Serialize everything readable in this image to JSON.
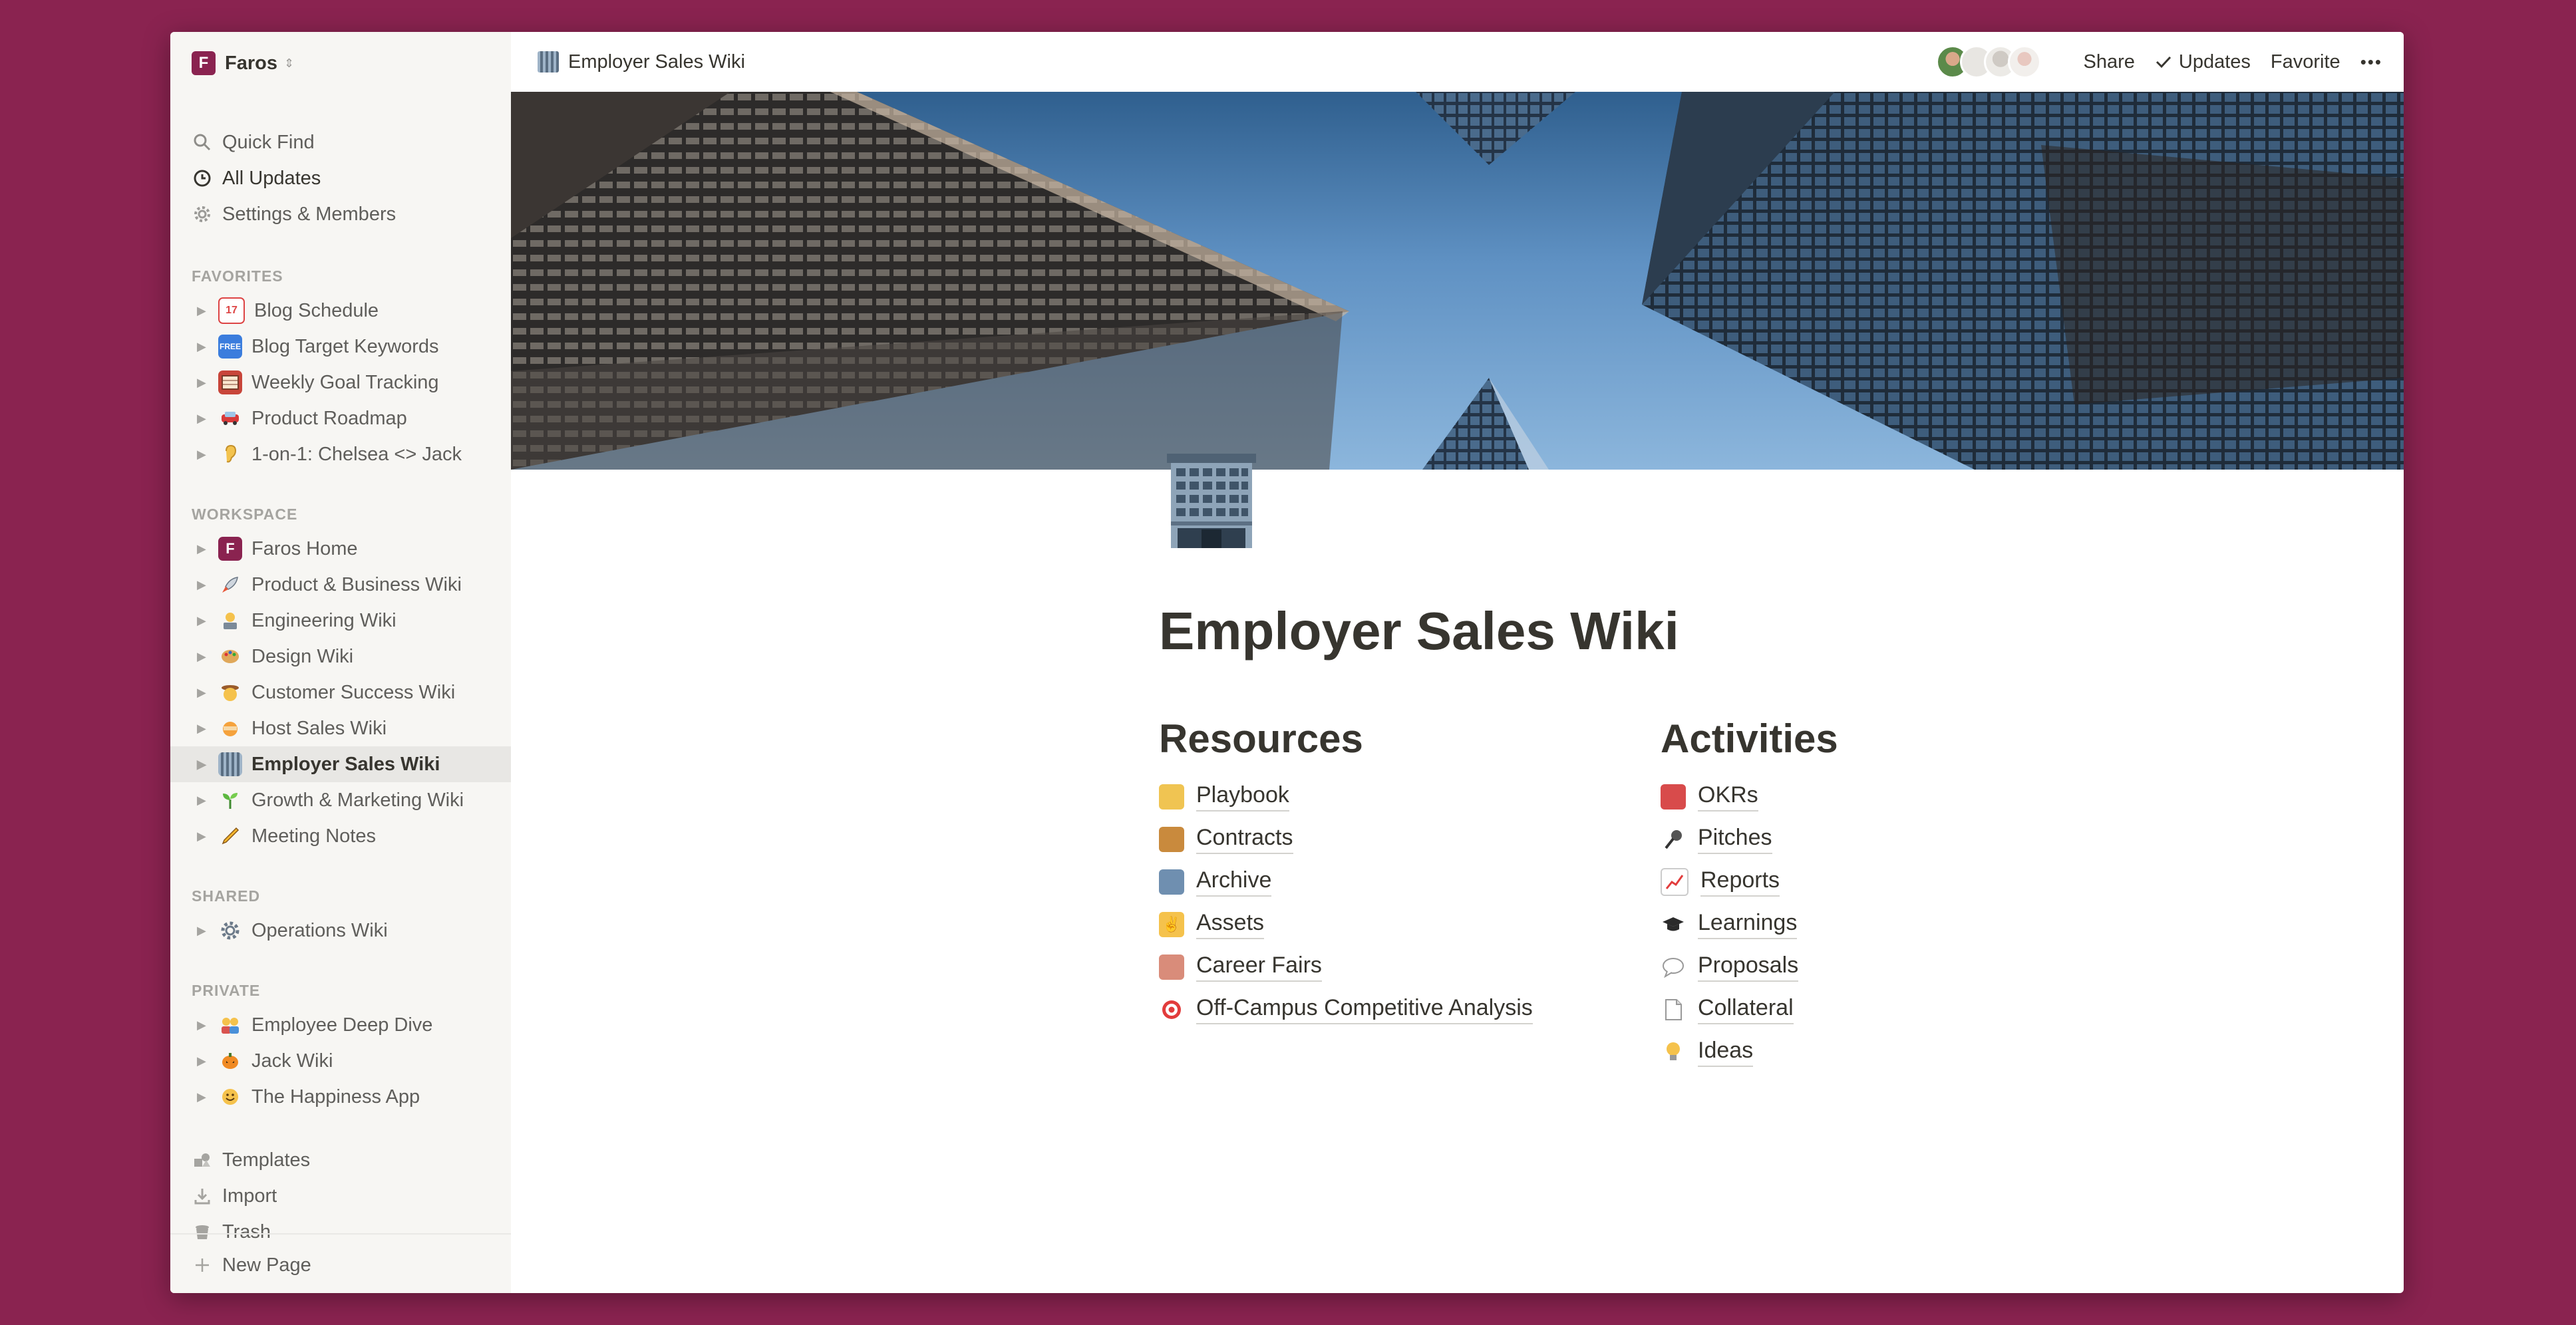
{
  "workspace": {
    "name": "Faros",
    "logo_letter": "F"
  },
  "sidebar": {
    "top_items": [
      {
        "label": "Quick Find",
        "icon": "search-icon"
      },
      {
        "label": "All Updates",
        "icon": "clock-icon"
      },
      {
        "label": "Settings & Members",
        "icon": "gear-icon"
      }
    ],
    "sections": {
      "favorites": "FAVORITES",
      "workspace": "WORKSPACE",
      "shared": "SHARED",
      "private": "PRIVATE"
    },
    "favorites": [
      {
        "label": "Blog Schedule",
        "icon": "calendar-icon"
      },
      {
        "label": "Blog Target Keywords",
        "icon": "free-badge-icon"
      },
      {
        "label": "Weekly Goal Tracking",
        "icon": "abacus-icon"
      },
      {
        "label": "Product Roadmap",
        "icon": "car-icon"
      },
      {
        "label": "1-on-1: Chelsea <> Jack",
        "icon": "ear-icon"
      }
    ],
    "workspace_pages": [
      {
        "label": "Faros Home",
        "icon": "faros-logo-icon"
      },
      {
        "label": "Product & Business Wiki",
        "icon": "rocket-icon"
      },
      {
        "label": "Engineering Wiki",
        "icon": "technologist-icon"
      },
      {
        "label": "Design Wiki",
        "icon": "palette-icon"
      },
      {
        "label": "Customer Success Wiki",
        "icon": "cowboy-icon"
      },
      {
        "label": "Host Sales Wiki",
        "icon": "ninja-icon"
      },
      {
        "label": "Employer Sales Wiki",
        "icon": "office-building-icon"
      },
      {
        "label": "Growth & Marketing Wiki",
        "icon": "seedling-icon"
      },
      {
        "label": "Meeting Notes",
        "icon": "pencil-icon"
      }
    ],
    "shared_pages": [
      {
        "label": "Operations Wiki",
        "icon": "gear-icon"
      }
    ],
    "private_pages": [
      {
        "label": "Employee Deep Dive",
        "icon": "people-icon"
      },
      {
        "label": "Jack Wiki",
        "icon": "pumpkin-icon"
      },
      {
        "label": "The Happiness App",
        "icon": "smile-icon"
      }
    ],
    "bottom_items": [
      {
        "label": "Templates",
        "icon": "templates-icon"
      },
      {
        "label": "Import",
        "icon": "import-icon"
      },
      {
        "label": "Trash",
        "icon": "trash-icon"
      }
    ],
    "new_page": "New Page"
  },
  "topbar": {
    "breadcrumb": "Employer Sales Wiki",
    "share": "Share",
    "updates": "Updates",
    "favorite": "Favorite",
    "more": "•••"
  },
  "page": {
    "title": "Employer Sales Wiki",
    "resources": {
      "heading": "Resources",
      "items": [
        {
          "label": "Playbook",
          "icon": "scroll-icon"
        },
        {
          "label": "Contracts",
          "icon": "ledger-icon"
        },
        {
          "label": "Archive",
          "icon": "folder-icon"
        },
        {
          "label": "Assets",
          "icon": "victory-hand-icon"
        },
        {
          "label": "Career Fairs",
          "icon": "carousel-horse-icon"
        },
        {
          "label": "Off-Campus Competitive Analysis",
          "icon": "target-icon"
        }
      ]
    },
    "activities": {
      "heading": "Activities",
      "items": [
        {
          "label": "OKRs",
          "icon": "open-book-icon"
        },
        {
          "label": "Pitches",
          "icon": "microphone-icon"
        },
        {
          "label": "Reports",
          "icon": "chart-up-icon"
        },
        {
          "label": "Learnings",
          "icon": "graduation-cap-icon"
        },
        {
          "label": "Proposals",
          "icon": "speech-bubble-icon"
        },
        {
          "label": "Collateral",
          "icon": "page-icon"
        },
        {
          "label": "Ideas",
          "icon": "light-bulb-icon"
        }
      ]
    }
  },
  "colors": {
    "brand": "#8a2350",
    "sidebar_bg": "#f7f6f3",
    "text": "#37352f",
    "muted": "#5f5e5b"
  }
}
